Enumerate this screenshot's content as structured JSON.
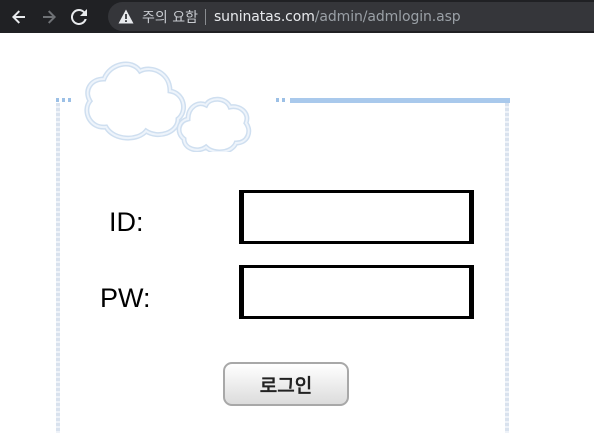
{
  "browser": {
    "security_label": "주의 요함",
    "url_host": "suninatas.com",
    "url_path": "/admin/admlogin.asp",
    "icons": {
      "back": "back-arrow-icon",
      "forward": "forward-arrow-icon",
      "reload": "reload-icon",
      "warning": "warning-triangle-icon"
    }
  },
  "login_form": {
    "id_label": "ID:",
    "pw_label": "PW:",
    "id_value": "",
    "pw_value": "",
    "submit_label": "로그인"
  },
  "colors": {
    "toolbar_bg": "#202124",
    "omnibox_bg": "#35363a",
    "frame_accent": "#a9c9ec"
  }
}
